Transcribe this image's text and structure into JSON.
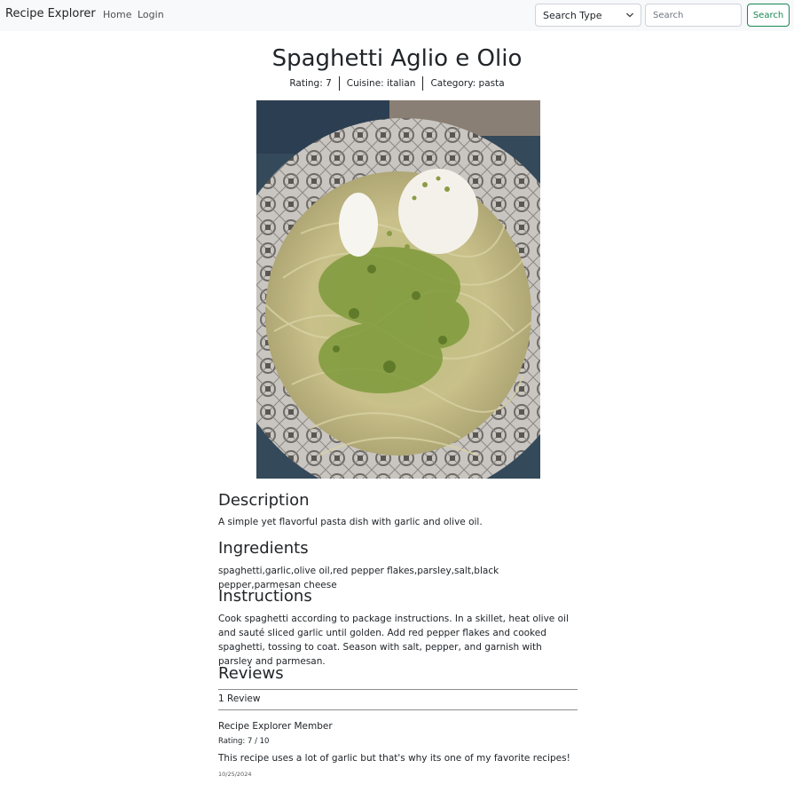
{
  "navbar": {
    "brand": "Recipe Explorer",
    "links": [
      "Home",
      "Login"
    ],
    "search_type_label": "Search Type",
    "search_placeholder": "Search",
    "search_button": "Search"
  },
  "recipe": {
    "title": "Spaghetti Aglio e Olio",
    "meta": [
      "Rating: 7",
      "Cuisine: italian",
      "Category: pasta"
    ],
    "description_heading": "Description",
    "description": "A simple yet flavorful pasta dish with garlic and olive oil.",
    "ingredients_heading": "Ingredients",
    "ingredients": "spaghetti,garlic,olive oil,red pepper flakes,parsley,salt,black pepper,parmesan cheese",
    "instructions_heading": "Instructions",
    "instructions": "Cook spaghetti according to package instructions. In a skillet, heat olive oil and sauté sliced garlic until golden. Add red pepper flakes and cooked spaghetti, tossing to coat. Season with salt, pepper, and garnish with parsley and parmesan."
  },
  "reviews": {
    "heading": "Reviews",
    "count_label": "1 Review",
    "items": [
      {
        "author": "Recipe Explorer Member",
        "rating": "Rating: 7 / 10",
        "text": "This recipe uses a lot of garlic but that's why its one of my favorite recipes!",
        "date": "10/25/2024"
      }
    ]
  },
  "colors": {
    "accent": "#198754",
    "navbar_bg": "#f8f9fa",
    "text": "#212529"
  },
  "icons": {
    "select_chevron": "chevron-down-icon"
  }
}
